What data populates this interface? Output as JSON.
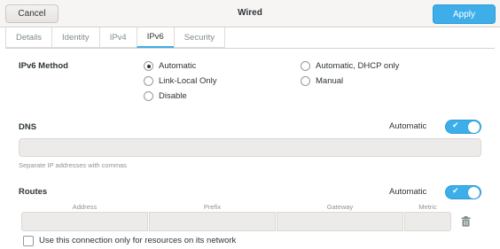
{
  "header": {
    "cancel_label": "Cancel",
    "title": "Wired",
    "apply_label": "Apply"
  },
  "tabs": [
    {
      "label": "Details"
    },
    {
      "label": "Identity"
    },
    {
      "label": "IPv4"
    },
    {
      "label": "IPv6"
    },
    {
      "label": "Security"
    }
  ],
  "active_tab": "IPv6",
  "ipv6_method": {
    "label": "IPv6 Method",
    "options": {
      "automatic": "Automatic",
      "automatic_dhcp": "Automatic, DHCP only",
      "link_local": "Link-Local Only",
      "manual": "Manual",
      "disable": "Disable"
    },
    "selected": "Automatic"
  },
  "dns": {
    "label": "DNS",
    "switch_label": "Automatic",
    "switch_on": true,
    "value": "",
    "hint": "Separate IP addresses with commas"
  },
  "routes": {
    "label": "Routes",
    "switch_label": "Automatic",
    "switch_on": true,
    "columns": {
      "address": "Address",
      "prefix": "Prefix",
      "gateway": "Gateway",
      "metric": "Metric"
    }
  },
  "only_local": {
    "label": "Use this connection only for resources on its network",
    "checked": false
  },
  "colors": {
    "accent": "#3daee9",
    "header_bg": "#f6f5f4",
    "entry_bg": "#ecebea"
  }
}
